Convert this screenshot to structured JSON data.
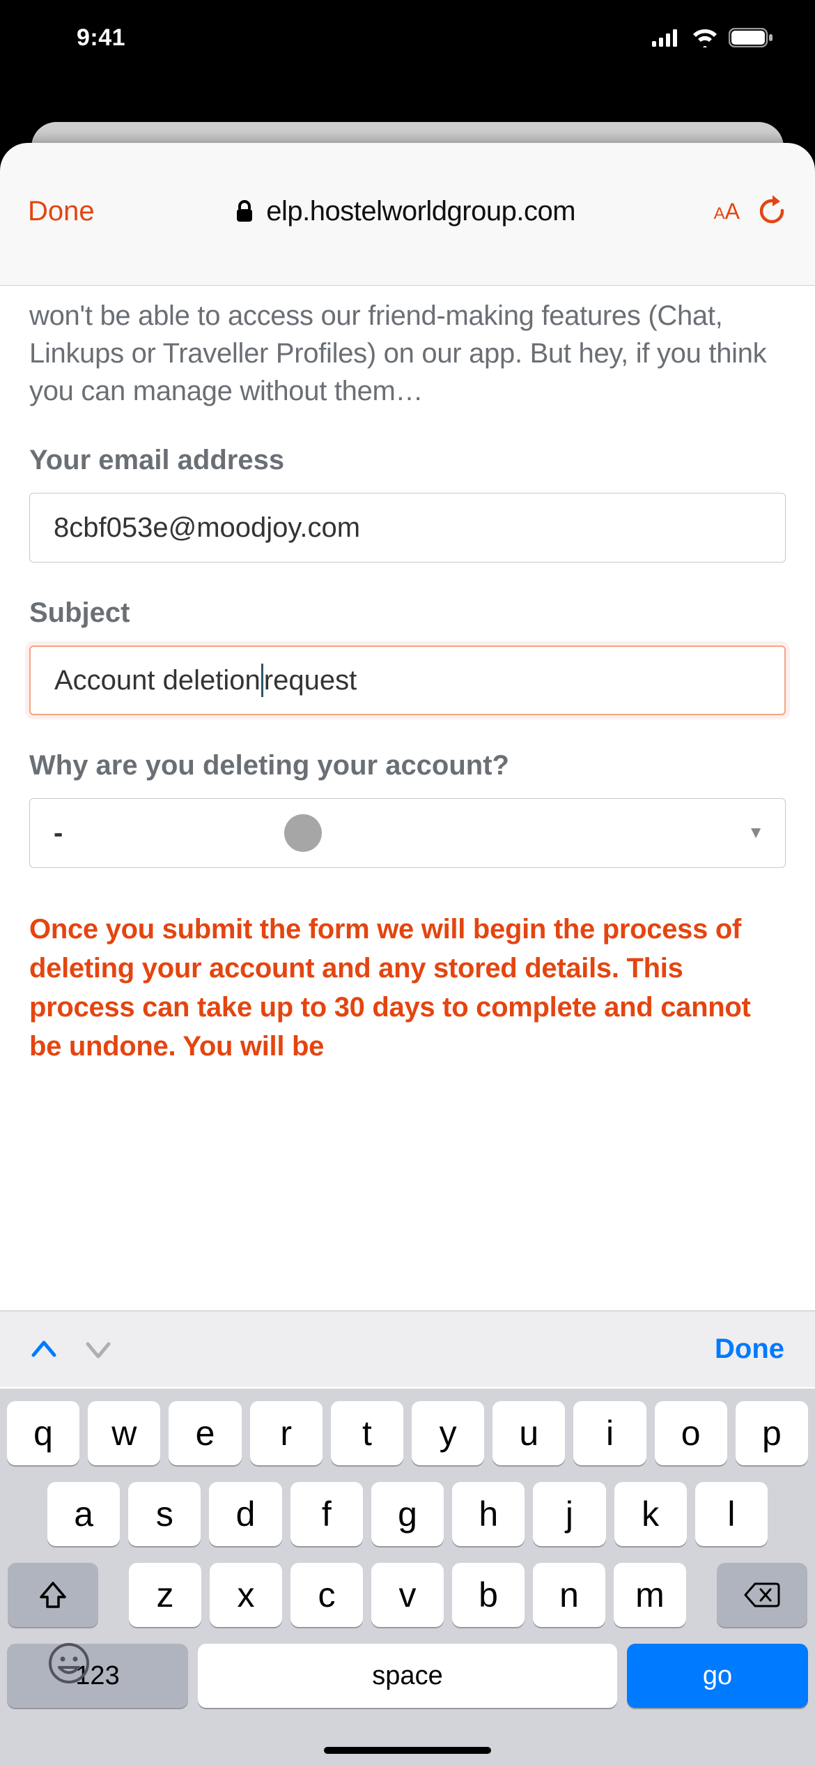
{
  "status_bar": {
    "time": "9:41"
  },
  "browser": {
    "done_label": "Done",
    "url_display": "elp.hostelworldgroup.com",
    "aa_label": "A"
  },
  "page": {
    "intro_text": "won't be able to access our friend-making features (Chat, Linkups or Traveller Profiles) on our app. But hey, if you think you can manage without them…",
    "email_label": "Your email address",
    "email_value": "8cbf053e@moodjoy.com",
    "subject_label": "Subject",
    "subject_value_before": "Account deletion",
    "subject_value_after": " request",
    "reason_label": "Why are you deleting your account?",
    "reason_value": "-",
    "warning_text": "Once you submit the form we will begin the process of deleting your account and any stored details. This process can take up to 30 days to complete and cannot be undone. You will be"
  },
  "keyboard_accessory": {
    "done_label": "Done"
  },
  "keyboard": {
    "row1": [
      "q",
      "w",
      "e",
      "r",
      "t",
      "y",
      "u",
      "i",
      "o",
      "p"
    ],
    "row2": [
      "a",
      "s",
      "d",
      "f",
      "g",
      "h",
      "j",
      "k",
      "l"
    ],
    "row3": [
      "z",
      "x",
      "c",
      "v",
      "b",
      "n",
      "m"
    ],
    "numeric_label": "123",
    "space_label": "space",
    "go_label": "go"
  }
}
